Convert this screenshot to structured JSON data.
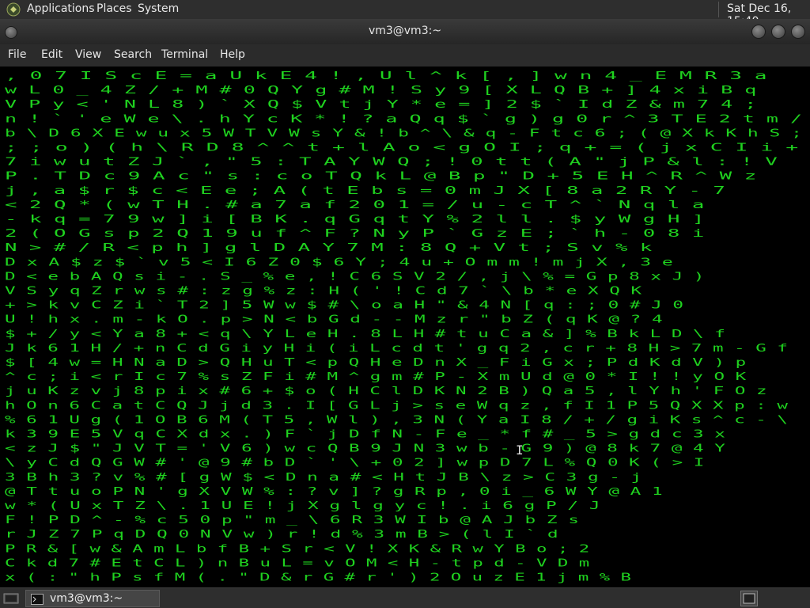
{
  "top_panel": {
    "menus": [
      "Applications",
      "Places",
      "System"
    ],
    "datetime": "Sat Dec 16, 15:40"
  },
  "window": {
    "title": "vm3@vm3:~",
    "menu": [
      "File",
      "Edit",
      "View",
      "Search",
      "Terminal",
      "Help"
    ]
  },
  "terminal": {
    "fg_color": "#1fd21f",
    "highlight_color": "#ffffff",
    "rows": [
      ",    0 7 I  S c E  =   a U k   E 4 !  , U l ^ k  [ , ] w n 4 _ E  M R 3 a",
      "w    L 0 _   4  Z  / + M #  0 Q Y g # M ! S y  9 [ X L Q B + ] 4 x i B q",
      "V    P y  <  '  N L 8 ) ` X   Q $ V t j Y * e  = ] 2 $ ` I d Z & m 7 4 ;",
      "n    !  `  '  e  W   e \\ . h Y c K *  ! ? a Q q $ ` g  ) g 0 r ^ 3 T  E 2 t m /",
      "b    \\ D  6  X E  w   u x 5 W T V W s Y & ! b ^ \\ & q - F  t c 6 ; ( @  X k K h S ;",
      ";     ;   o  ) (  h   \\ R D 8 ^ ^ t + l A o < g O I  ; q +  = (  j x C I i +",
      "7    i   w  u t Z J   ` , \" 5 : T  A Y W Q ; ! 0 t  t ( A \" j  P & l : ! V",
      "P     .   T D c 9  A c \" s :  c o T  Q k L @ B p \"  D + 5 E  H ^ R ^ W z",
      "j     ,   a $ r $  c < E e ; A (  t E b s = 0 m  J X [ 8  a 2 R Y - 7",
      "<     2   Q * ( w  T H . # a 7  a f 2 0 1 = / u  - c T  ^ ` N q l a",
      "-     k   q = 7 9  w ] i [ B K  . q G q t Y %  2 l l  . $ y W g H ]",
      "2     (   O G s p 2  Q 1 9 u f ^  F ? N y P `  G z E  ; ` h - 0 8 i",
      "N     >   # / R < p  h ] g l D A  Y 7 M : 8  Q + V t ; S v % k",
      "D x A $  z $ ` v 5 < I  6 Z 0 $ 6 Y ; 4 u + O m  m ! m j X , 3 e",
      "D < e b A  Q s i - . S  _ % e , ! C 6 S V 2 / , j \\ % = G p 8 x J )",
      "V S y q Z  r w s # : z  g % z : H ( ' ! C d 7 ` \\ b * e X Q K",
      "+ > k v C  Z i ` T 2 ] 5  W w $ # \\ o a H \" & 4 N [ q : ; 0 # J 0",
      "U ! h x .  m - k O . p >  N < b G d - - M z r \" b Z ( q K @ ? 4",
      "$ + / y <  Y a 8 + < q \\  Y L e H . 8 L H # t u C a & ] % B k L D \\ f",
      "J k 6 1 H /  + n C d G i y  H i ( i L c d t ' g q 2 , c r + 8 H > 7 m - G f",
      "$ [ 4 w =  H N a D > Q H  u T < p Q H e D n X _ F i G x ; P d K d V ) p",
      "^ c ; i < r  I c 7 % s Z F  i # M ^ g m # P - X m U d @ 0 * I ! ! y O K",
      "j u K z v j  8 p i x # 6 +  $ o ( H C l D K N 2 B ) Q a 5 , l Y h ' F O z",
      "h O n 6 C a t  C Q J j d 3 .  I [ G L j > s e W q z , f I 1 P 5 Q X X p : w",
      "% 6 1 U g (  1 O B 6 M ( T  5 , W l ) , 3 N ( Y a I 8 / + / g i K s ^ c - \\",
      "k 3 9 E 5 V  q C X d x . )  F ` j D f N - F e _ * f # _ 5 > g d c 3 x",
      "< z J $ \" J V  T = '  V 6 ) w c Q B 9 J N 3 w b - G 9 ) @ 8 k 7 @ 4 Y",
      "\\ y C d Q G W  # '  @ 9 # b D ` ' \\ + 0 2 ] w p D 7 L % Q 0 K ( > I",
      "3 B h 3 ? v %  #  [ g W $ < D n a # < H t J B \\ z > C 3 g - j",
      "@ T t u o P N  ' g  X V W % : ? v ] ? g R p , 0 i _ 6 W Y @ A 1",
      "w * ( U x T  Z \\  . 1 U E ! j X g l g y c ! . i 6 g P / J",
      "F ! P D ^ -  % c  5 0 p \" m _ \\ 6 R 3 W I b @ A J b Z s",
      "r J Z 7 P q  D  Q 0 N V w ) r ! d % 3 m B > ( l I ` d",
      "P R & [ w &  A m L b f B + S r < V ! X K & R w Y B o ; 2",
      "C k d 7 # E  t C L ) n B u L = v O M < H - t p d - V D m",
      "x ( : \" h P  s f M ( . \" D & r G # r ' ) 2 O u z E 1 j m % B"
    ]
  },
  "taskbar": {
    "task_label": "vm3@vm3:~"
  }
}
